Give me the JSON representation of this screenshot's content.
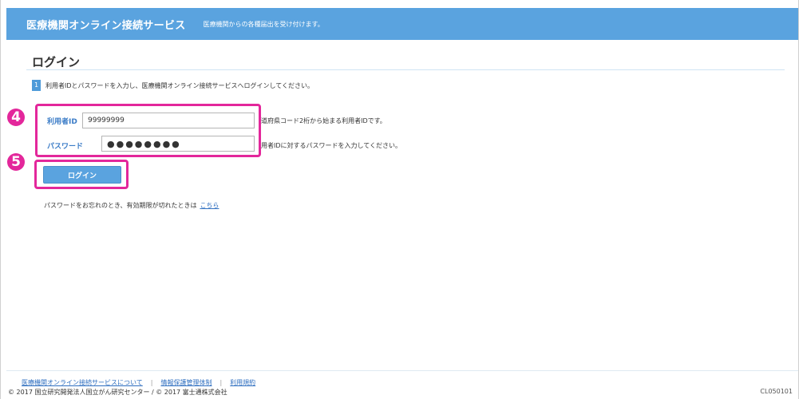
{
  "header": {
    "app_title": "医療機関オンライン接続サービス",
    "description": "医療機関からの各種届出を受け付けます。"
  },
  "page": {
    "title": "ログイン"
  },
  "step": {
    "number": "1",
    "text": "利用者IDとパスワードを入力し、医療機関オンライン接続サービスへログインしてください。"
  },
  "form": {
    "user_id": {
      "label": "利用者ID",
      "value": "99999999",
      "hint": "道府県コード2桁から始まる利用者IDです。"
    },
    "password": {
      "label": "パスワード",
      "value": "●●●●●●●●",
      "hint": "用者IDに対するパスワードを入力してください。"
    },
    "login_button": "ログイン"
  },
  "annotations": {
    "marker_4": "4",
    "marker_5": "5",
    "color": "#e3279b"
  },
  "forgot": {
    "text": "パスワードをお忘れのとき、有効期限が切れたときは",
    "link": "こちら"
  },
  "footer": {
    "links": [
      "医療機関オンライン接続サービスについて",
      "情報保護管理体制",
      "利用規約"
    ],
    "separator": "|",
    "copyright": "© 2017 国立研究開発法人国立がん研究センター / © 2017 富士通株式会社",
    "screen_id": "CL050101"
  },
  "colors": {
    "header_bg": "#5aa3df",
    "label_blue": "#3b7cc7",
    "link_blue": "#2f6fc0"
  }
}
